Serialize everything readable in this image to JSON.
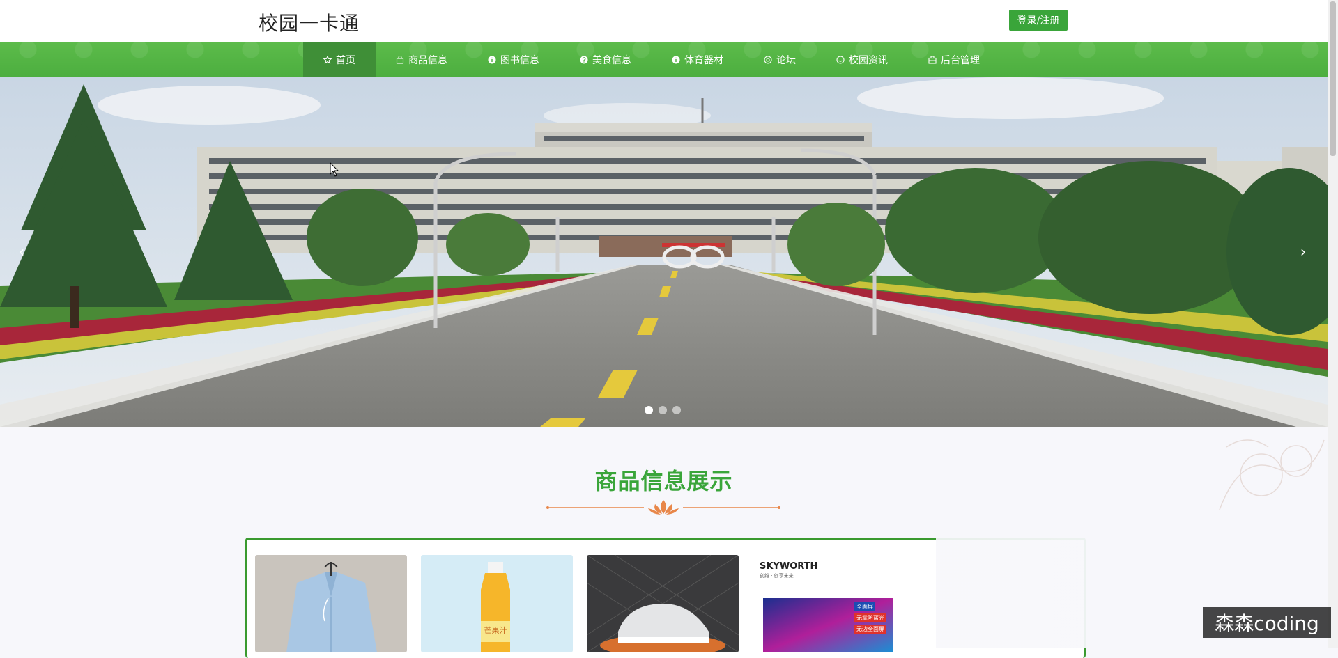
{
  "header": {
    "site_title": "校园一卡通",
    "login_label": "登录/注册"
  },
  "nav": {
    "items": [
      {
        "label": "首页",
        "icon": "star-icon",
        "active": true
      },
      {
        "label": "商品信息",
        "icon": "bag-icon"
      },
      {
        "label": "图书信息",
        "icon": "info-icon"
      },
      {
        "label": "美食信息",
        "icon": "help-icon"
      },
      {
        "label": "体育器材",
        "icon": "info-icon"
      },
      {
        "label": "论坛",
        "icon": "at-icon"
      },
      {
        "label": "校园资讯",
        "icon": "smile-icon"
      },
      {
        "label": "后台管理",
        "icon": "briefcase-icon"
      }
    ]
  },
  "banner": {
    "prev_glyph": "‹",
    "next_glyph": "›",
    "slide_count": 3,
    "active_slide": 1
  },
  "section": {
    "title": "商品信息展示"
  },
  "products": {
    "brand_text": "SKYWORTH",
    "brand_sub": "创维 · 创享未来",
    "tv_badge_top": "全面屏",
    "tv_badge_1": "无掌防蓝光",
    "tv_badge_2": "无边全面屏",
    "bottle_label": "芒果汁"
  },
  "watermark": "森森coding",
  "colors": {
    "accent": "#3aa53a",
    "nav_active": "#3f8f37",
    "divider": "#e8874a"
  }
}
